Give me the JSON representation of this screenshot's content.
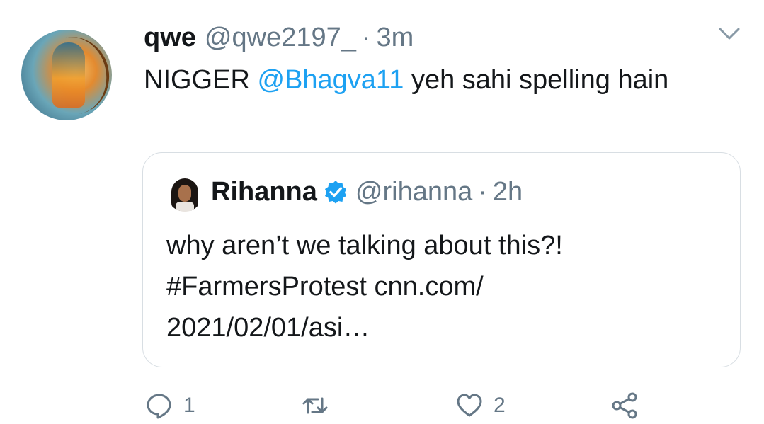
{
  "tweet": {
    "name": "qwe",
    "handle": "@qwe2197_",
    "separator": "·",
    "time": "3m",
    "text_start": "NIGGER",
    "mention": "@Bhagva11",
    "text_end": "yeh sahi spelling hain"
  },
  "quoted": {
    "name": "Rihanna",
    "verified": true,
    "handle": "@rihanna",
    "separator": "·",
    "time": "2h",
    "line1": "why aren’t we talking about this?!",
    "line2": "#FarmersProtest cnn.com/",
    "line3": "2021/02/01/asi…"
  },
  "actions": {
    "reply_count": "1",
    "like_count": "2"
  },
  "colors": {
    "accent": "#1da1f2",
    "muted": "#657786",
    "text": "#14171a",
    "border": "#d8dee3"
  },
  "icons": [
    "reply-icon",
    "retweet-icon",
    "like-icon",
    "share-icon",
    "chevron-down-icon",
    "verified-icon"
  ]
}
